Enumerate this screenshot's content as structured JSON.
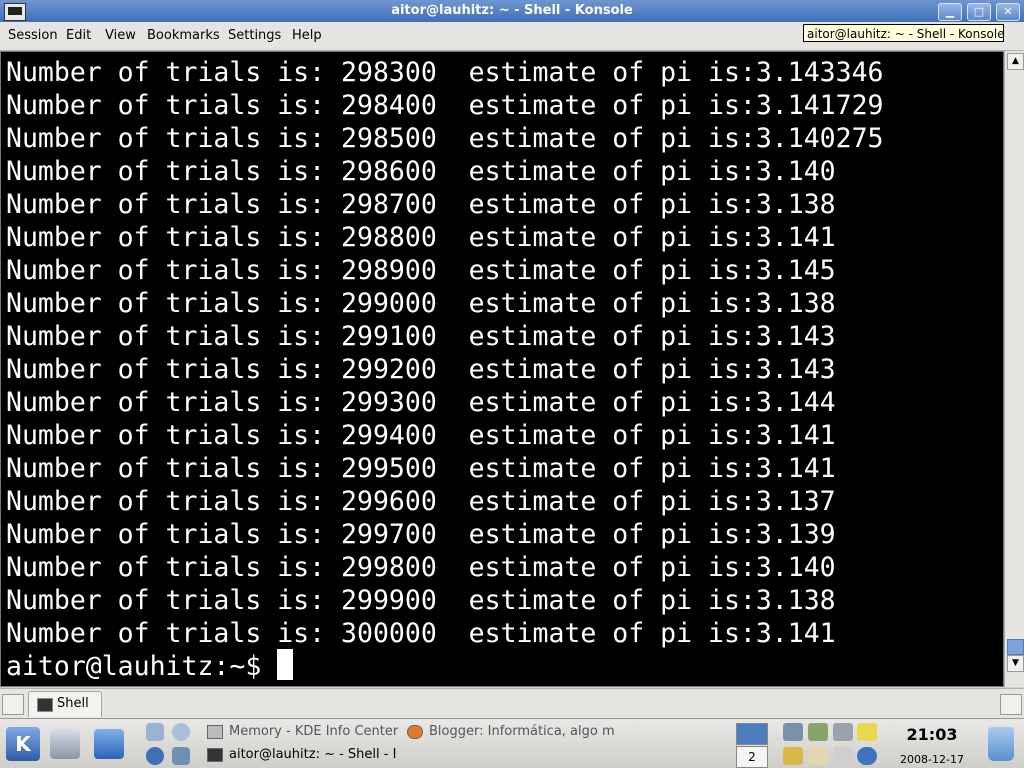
{
  "window": {
    "title": "aitor@lauhitz: ~ - Shell - Konsole",
    "tooltip": "aitor@lauhitz: ~ - Shell - Konsole",
    "minimize": "▁",
    "maximize": "□",
    "close": "✕"
  },
  "menu": [
    "Session",
    "Edit",
    "View",
    "Bookmarks",
    "Settings",
    "Help"
  ],
  "terminal": {
    "lines": [
      "Number of trials is: 298300  estimate of pi is:3.143346",
      "Number of trials is: 298400  estimate of pi is:3.141729",
      "Number of trials is: 298500  estimate of pi is:3.140275",
      "Number of trials is: 298600  estimate of pi is:3.140",
      "Number of trials is: 298700  estimate of pi is:3.138",
      "Number of trials is: 298800  estimate of pi is:3.141",
      "Number of trials is: 298900  estimate of pi is:3.145",
      "Number of trials is: 299000  estimate of pi is:3.138",
      "Number of trials is: 299100  estimate of pi is:3.143",
      "Number of trials is: 299200  estimate of pi is:3.143",
      "Number of trials is: 299300  estimate of pi is:3.144",
      "Number of trials is: 299400  estimate of pi is:3.141",
      "Number of trials is: 299500  estimate of pi is:3.141",
      "Number of trials is: 299600  estimate of pi is:3.137",
      "Number of trials is: 299700  estimate of pi is:3.139",
      "Number of trials is: 299800  estimate of pi is:3.140",
      "Number of trials is: 299900  estimate of pi is:3.138",
      "Number of trials is: 300000  estimate of pi is:3.141"
    ],
    "prompt": "aitor@lauhitz:~$ "
  },
  "scrollbar": {
    "up": "▲",
    "down": "▼"
  },
  "tabs": [
    {
      "label": "Shell"
    }
  ],
  "taskbar": {
    "tasks": [
      {
        "label": "Memory - KDE Info Center",
        "active": false
      },
      {
        "label": "Blogger: Informática, algo m",
        "active": false
      },
      {
        "label": "aitor@lauhitz: ~ - Shell - I",
        "active": true
      }
    ],
    "kmenu_label": "K",
    "pager": [
      "",
      "2"
    ],
    "clock": "21:03",
    "date": "2008-12-17"
  },
  "colors": {
    "terminal_bg": "#000000",
    "terminal_fg": "#ffffff",
    "titlebar": "#3e6fb8"
  }
}
